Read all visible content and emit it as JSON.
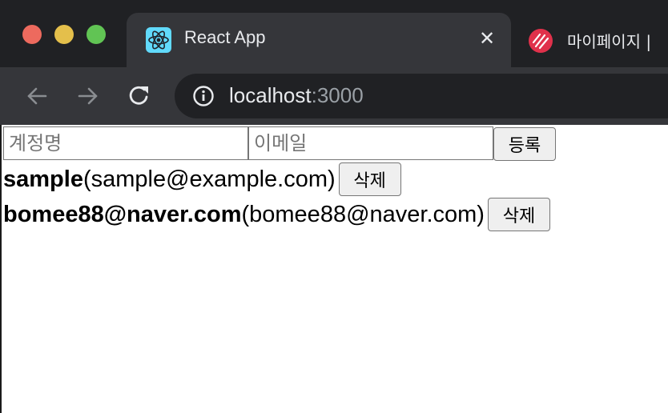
{
  "browser": {
    "active_tab": {
      "title": "React App",
      "favicon": "react-logo-icon",
      "close": "✕"
    },
    "inactive_tab": {
      "title": "마이페이지 |",
      "favicon": "brand-logo-icon"
    },
    "address": {
      "host": "localhost",
      "port": ":3000",
      "icon": "info-icon"
    },
    "nav": {
      "back": "back-arrow-icon",
      "forward": "forward-arrow-icon",
      "reload": "reload-icon"
    }
  },
  "form": {
    "account_placeholder": "계정명",
    "email_placeholder": "이메일",
    "register_label": "등록"
  },
  "users": [
    {
      "username": "sample",
      "email": "(sample@example.com)",
      "delete_label": "삭제"
    },
    {
      "username": "bomee88@naver.com",
      "email": "(bomee88@naver.com)",
      "delete_label": "삭제"
    }
  ],
  "colors": {
    "traffic_red": "#ed6a5e",
    "traffic_yellow": "#e4bf4b",
    "traffic_green": "#61c454",
    "react_blue": "#61dafb",
    "brand_red": "#e0314b"
  }
}
